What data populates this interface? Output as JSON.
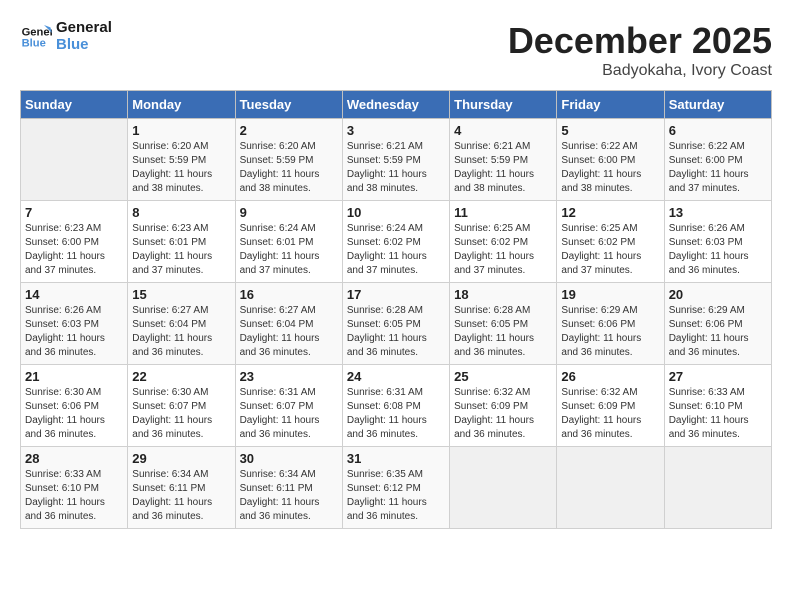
{
  "header": {
    "logo_line1": "General",
    "logo_line2": "Blue",
    "month": "December 2025",
    "location": "Badyokaha, Ivory Coast"
  },
  "weekdays": [
    "Sunday",
    "Monday",
    "Tuesday",
    "Wednesday",
    "Thursday",
    "Friday",
    "Saturday"
  ],
  "weeks": [
    [
      {
        "day": "",
        "sunrise": "",
        "sunset": "",
        "daylight": ""
      },
      {
        "day": "1",
        "sunrise": "Sunrise: 6:20 AM",
        "sunset": "Sunset: 5:59 PM",
        "daylight": "Daylight: 11 hours and 38 minutes."
      },
      {
        "day": "2",
        "sunrise": "Sunrise: 6:20 AM",
        "sunset": "Sunset: 5:59 PM",
        "daylight": "Daylight: 11 hours and 38 minutes."
      },
      {
        "day": "3",
        "sunrise": "Sunrise: 6:21 AM",
        "sunset": "Sunset: 5:59 PM",
        "daylight": "Daylight: 11 hours and 38 minutes."
      },
      {
        "day": "4",
        "sunrise": "Sunrise: 6:21 AM",
        "sunset": "Sunset: 5:59 PM",
        "daylight": "Daylight: 11 hours and 38 minutes."
      },
      {
        "day": "5",
        "sunrise": "Sunrise: 6:22 AM",
        "sunset": "Sunset: 6:00 PM",
        "daylight": "Daylight: 11 hours and 38 minutes."
      },
      {
        "day": "6",
        "sunrise": "Sunrise: 6:22 AM",
        "sunset": "Sunset: 6:00 PM",
        "daylight": "Daylight: 11 hours and 37 minutes."
      }
    ],
    [
      {
        "day": "7",
        "sunrise": "Sunrise: 6:23 AM",
        "sunset": "Sunset: 6:00 PM",
        "daylight": "Daylight: 11 hours and 37 minutes."
      },
      {
        "day": "8",
        "sunrise": "Sunrise: 6:23 AM",
        "sunset": "Sunset: 6:01 PM",
        "daylight": "Daylight: 11 hours and 37 minutes."
      },
      {
        "day": "9",
        "sunrise": "Sunrise: 6:24 AM",
        "sunset": "Sunset: 6:01 PM",
        "daylight": "Daylight: 11 hours and 37 minutes."
      },
      {
        "day": "10",
        "sunrise": "Sunrise: 6:24 AM",
        "sunset": "Sunset: 6:02 PM",
        "daylight": "Daylight: 11 hours and 37 minutes."
      },
      {
        "day": "11",
        "sunrise": "Sunrise: 6:25 AM",
        "sunset": "Sunset: 6:02 PM",
        "daylight": "Daylight: 11 hours and 37 minutes."
      },
      {
        "day": "12",
        "sunrise": "Sunrise: 6:25 AM",
        "sunset": "Sunset: 6:02 PM",
        "daylight": "Daylight: 11 hours and 37 minutes."
      },
      {
        "day": "13",
        "sunrise": "Sunrise: 6:26 AM",
        "sunset": "Sunset: 6:03 PM",
        "daylight": "Daylight: 11 hours and 36 minutes."
      }
    ],
    [
      {
        "day": "14",
        "sunrise": "Sunrise: 6:26 AM",
        "sunset": "Sunset: 6:03 PM",
        "daylight": "Daylight: 11 hours and 36 minutes."
      },
      {
        "day": "15",
        "sunrise": "Sunrise: 6:27 AM",
        "sunset": "Sunset: 6:04 PM",
        "daylight": "Daylight: 11 hours and 36 minutes."
      },
      {
        "day": "16",
        "sunrise": "Sunrise: 6:27 AM",
        "sunset": "Sunset: 6:04 PM",
        "daylight": "Daylight: 11 hours and 36 minutes."
      },
      {
        "day": "17",
        "sunrise": "Sunrise: 6:28 AM",
        "sunset": "Sunset: 6:05 PM",
        "daylight": "Daylight: 11 hours and 36 minutes."
      },
      {
        "day": "18",
        "sunrise": "Sunrise: 6:28 AM",
        "sunset": "Sunset: 6:05 PM",
        "daylight": "Daylight: 11 hours and 36 minutes."
      },
      {
        "day": "19",
        "sunrise": "Sunrise: 6:29 AM",
        "sunset": "Sunset: 6:06 PM",
        "daylight": "Daylight: 11 hours and 36 minutes."
      },
      {
        "day": "20",
        "sunrise": "Sunrise: 6:29 AM",
        "sunset": "Sunset: 6:06 PM",
        "daylight": "Daylight: 11 hours and 36 minutes."
      }
    ],
    [
      {
        "day": "21",
        "sunrise": "Sunrise: 6:30 AM",
        "sunset": "Sunset: 6:06 PM",
        "daylight": "Daylight: 11 hours and 36 minutes."
      },
      {
        "day": "22",
        "sunrise": "Sunrise: 6:30 AM",
        "sunset": "Sunset: 6:07 PM",
        "daylight": "Daylight: 11 hours and 36 minutes."
      },
      {
        "day": "23",
        "sunrise": "Sunrise: 6:31 AM",
        "sunset": "Sunset: 6:07 PM",
        "daylight": "Daylight: 11 hours and 36 minutes."
      },
      {
        "day": "24",
        "sunrise": "Sunrise: 6:31 AM",
        "sunset": "Sunset: 6:08 PM",
        "daylight": "Daylight: 11 hours and 36 minutes."
      },
      {
        "day": "25",
        "sunrise": "Sunrise: 6:32 AM",
        "sunset": "Sunset: 6:09 PM",
        "daylight": "Daylight: 11 hours and 36 minutes."
      },
      {
        "day": "26",
        "sunrise": "Sunrise: 6:32 AM",
        "sunset": "Sunset: 6:09 PM",
        "daylight": "Daylight: 11 hours and 36 minutes."
      },
      {
        "day": "27",
        "sunrise": "Sunrise: 6:33 AM",
        "sunset": "Sunset: 6:10 PM",
        "daylight": "Daylight: 11 hours and 36 minutes."
      }
    ],
    [
      {
        "day": "28",
        "sunrise": "Sunrise: 6:33 AM",
        "sunset": "Sunset: 6:10 PM",
        "daylight": "Daylight: 11 hours and 36 minutes."
      },
      {
        "day": "29",
        "sunrise": "Sunrise: 6:34 AM",
        "sunset": "Sunset: 6:11 PM",
        "daylight": "Daylight: 11 hours and 36 minutes."
      },
      {
        "day": "30",
        "sunrise": "Sunrise: 6:34 AM",
        "sunset": "Sunset: 6:11 PM",
        "daylight": "Daylight: 11 hours and 36 minutes."
      },
      {
        "day": "31",
        "sunrise": "Sunrise: 6:35 AM",
        "sunset": "Sunset: 6:12 PM",
        "daylight": "Daylight: 11 hours and 36 minutes."
      },
      {
        "day": "",
        "sunrise": "",
        "sunset": "",
        "daylight": ""
      },
      {
        "day": "",
        "sunrise": "",
        "sunset": "",
        "daylight": ""
      },
      {
        "day": "",
        "sunrise": "",
        "sunset": "",
        "daylight": ""
      }
    ]
  ]
}
